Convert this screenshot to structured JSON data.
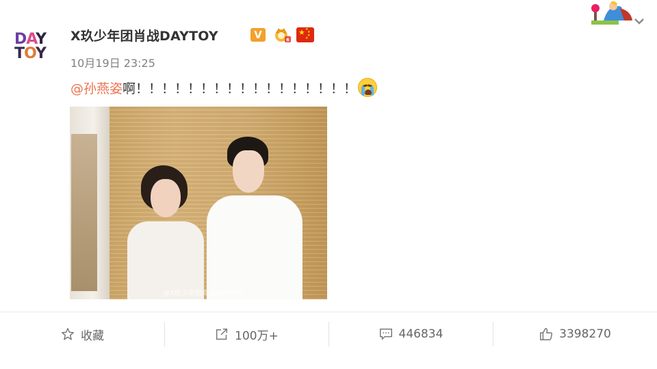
{
  "account": {
    "avatar_line1": "DAY",
    "avatar_line2": "TOY",
    "username": "X玖少年团肖战DAYTOY",
    "verified_badge": "V",
    "badges": [
      "verified-v-icon",
      "crown-badge-icon",
      "china-flag-icon"
    ]
  },
  "post": {
    "timestamp": "10月19日 23:25",
    "mention": "@孙燕姿",
    "text": " 啊！！！！！！！！！！！！！！！！！",
    "emoji": "crying-face-icon",
    "photo_watermark": "@X玖少年团肖战DAYTOY"
  },
  "actions": {
    "favorite": {
      "label": "收藏",
      "icon": "star-outline-icon"
    },
    "share": {
      "label": "100万+",
      "icon": "share-arrow-icon"
    },
    "comment": {
      "label": "446834",
      "icon": "comment-bubble-icon"
    },
    "like": {
      "label": "3398270",
      "icon": "thumbs-up-icon"
    }
  },
  "colors": {
    "mention": "#eb7350",
    "text": "#333333",
    "muted": "#808080",
    "badge_v": "#f3a12b",
    "flag_red": "#de2910"
  }
}
